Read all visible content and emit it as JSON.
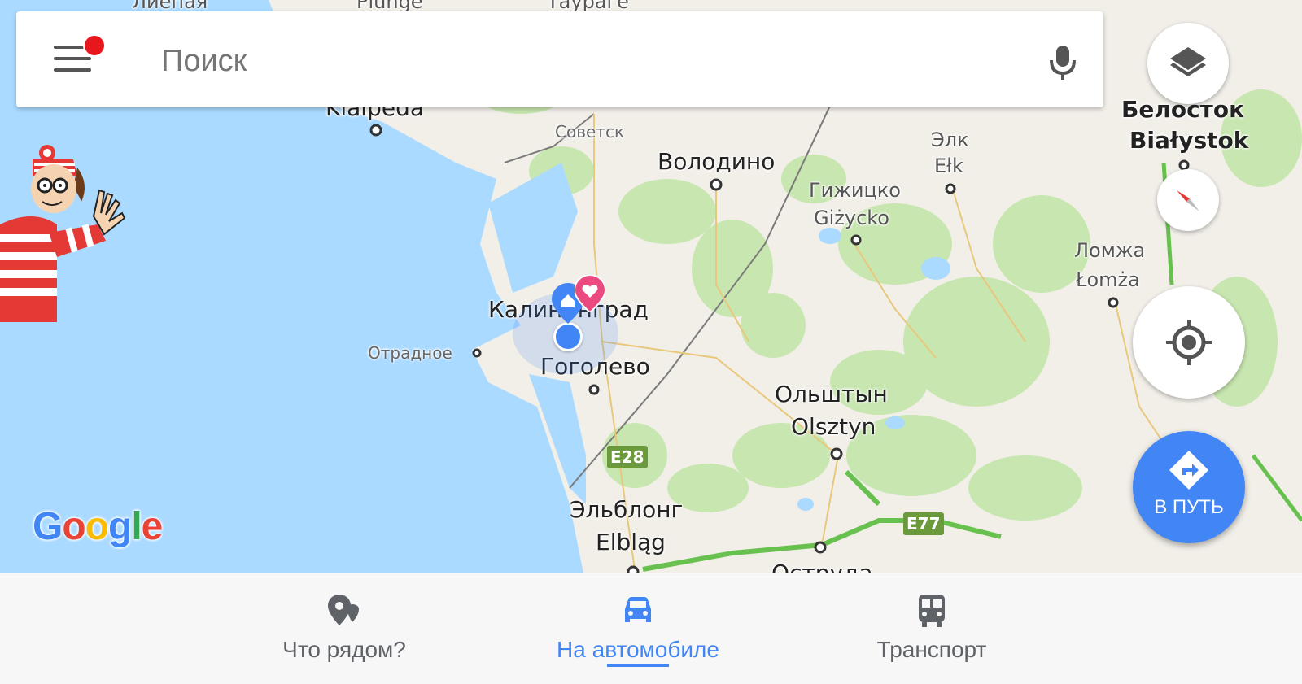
{
  "search": {
    "placeholder": "Поиск"
  },
  "map": {
    "labels": {
      "liepaja": "Лиепая",
      "plunge": "Plungė",
      "taurage": "Таураге",
      "klaipeda": "Klaipėda",
      "sovetsk": "Советск",
      "volodino": "Володино",
      "elk_ru": "Элк",
      "elk_pl": "Ełk",
      "bialystok_ru": "Белосток",
      "bialystok_pl": "Białystok",
      "gizycko_ru": "Гижицко",
      "gizycko_pl": "Giżycko",
      "lomza_ru": "Ломжа",
      "lomza_pl": "Łomża",
      "kaliningrad": "Калининград",
      "otradnoe": "Отрадное",
      "gogolevo": "Гоголево",
      "olsztyn_ru": "Ольштын",
      "olsztyn_pl": "Olsztyn",
      "elblag_ru": "Эльблонг",
      "elblag_pl": "Elbląg",
      "ostruda": "Оструда"
    },
    "shields": {
      "e28": "E28",
      "e77": "E77"
    },
    "colors": {
      "water": "#aadaff",
      "land": "#f2efe9",
      "forest": "#c8e6b0",
      "highway": "#68c14f",
      "border": "#7a7a7a",
      "location_dot": "#4285f4",
      "favorite_pin": "#ea4a7f"
    }
  },
  "controls": {
    "layers_icon": "layers-icon",
    "compass_icon": "compass-icon",
    "my_location_icon": "my-location-icon",
    "go_button_label": "В ПУТЬ"
  },
  "logo": {
    "text_g": "G",
    "text_o1": "o",
    "text_o2": "o",
    "text_g2": "g",
    "text_l": "l",
    "text_e": "e",
    "colors": [
      "#4285f4",
      "#ea4335",
      "#fbbc05",
      "#4285f4",
      "#34a853",
      "#ea4335"
    ]
  },
  "bottom_nav": {
    "items": [
      {
        "label": "Что рядом?",
        "icon": "explore-pins-icon",
        "active": false
      },
      {
        "label": "На автомобиле",
        "icon": "car-icon",
        "active": true
      },
      {
        "label": "Транспорт",
        "icon": "transit-bus-icon",
        "active": false
      }
    ]
  }
}
